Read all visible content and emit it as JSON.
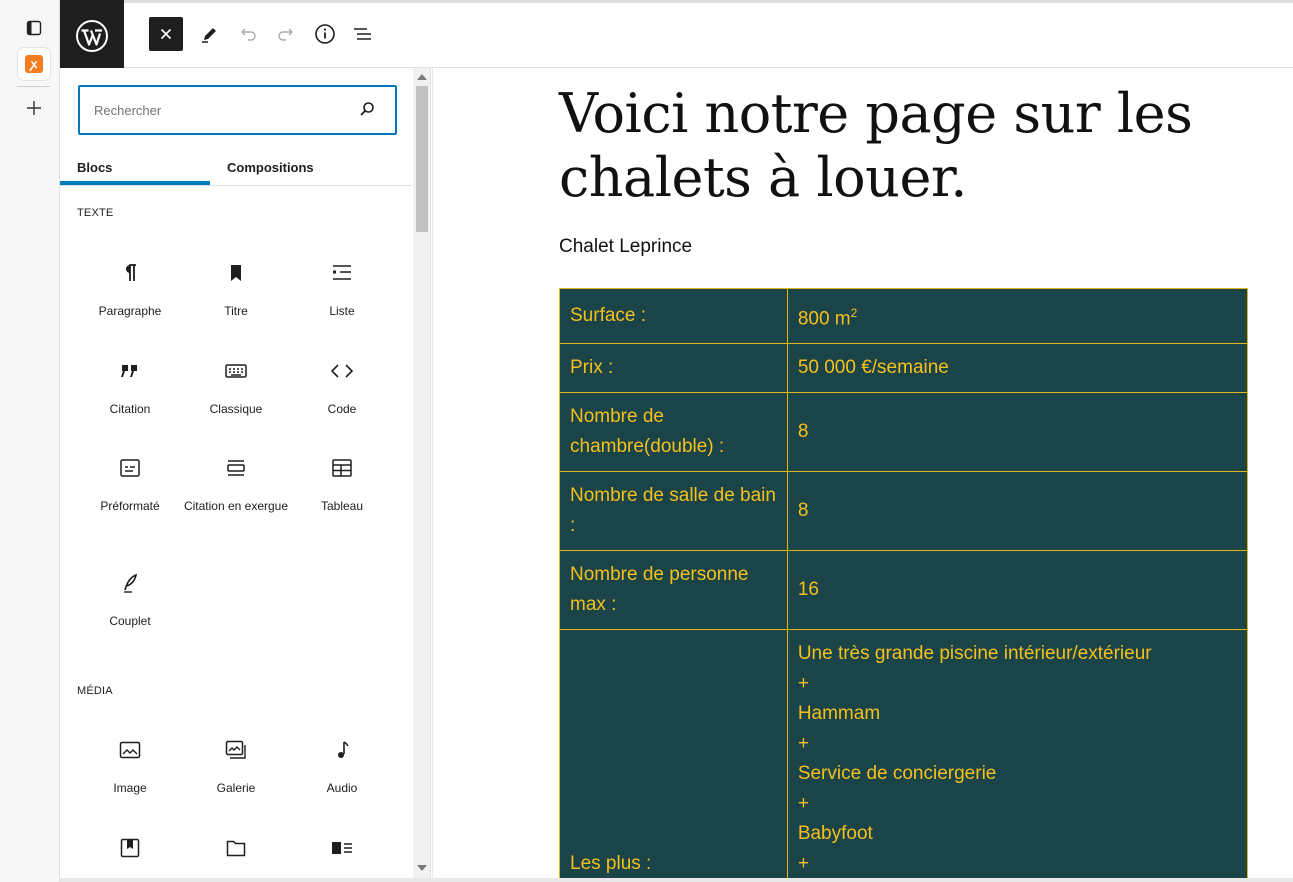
{
  "browser_rail": {
    "items": [
      {
        "icon": "sidebar-toggle-icon"
      },
      {
        "icon": "xampp-icon",
        "glyph": "ꭗ"
      },
      {
        "icon": "plus-icon"
      }
    ]
  },
  "toolbar": {
    "logo_icon": "wordpress-logo-icon",
    "close_label": "Fermer",
    "buttons": [
      "close-icon",
      "pencil-icon",
      "undo-icon",
      "redo-icon",
      "info-icon",
      "list-view-icon"
    ]
  },
  "inserter": {
    "search_placeholder": "Rechercher",
    "tabs": [
      {
        "label": "Blocs",
        "active": true
      },
      {
        "label": "Compositions",
        "active": false
      }
    ],
    "categories": [
      {
        "label": "TEXTE",
        "blocks": [
          {
            "label": "Paragraphe",
            "icon": "paragraph-icon"
          },
          {
            "label": "Titre",
            "icon": "bookmark-icon"
          },
          {
            "label": "Liste",
            "icon": "list-icon"
          },
          {
            "label": "Citation",
            "icon": "quote-icon"
          },
          {
            "label": "Classique",
            "icon": "keyboard-icon"
          },
          {
            "label": "Code",
            "icon": "code-icon"
          },
          {
            "label": "Préformaté",
            "icon": "preformatted-icon"
          },
          {
            "label": "Citation en exergue",
            "icon": "pullquote-icon"
          },
          {
            "label": "Tableau",
            "icon": "table-icon"
          },
          {
            "label": "Couplet",
            "icon": "feather-icon"
          }
        ]
      },
      {
        "label": "MÉDIA",
        "blocks": [
          {
            "label": "Image",
            "icon": "image-icon"
          },
          {
            "label": "Galerie",
            "icon": "gallery-icon"
          },
          {
            "label": "Audio",
            "icon": "audio-icon"
          },
          {
            "label": "",
            "icon": "cover-icon"
          },
          {
            "label": "",
            "icon": "file-icon"
          },
          {
            "label": "",
            "icon": "media-text-icon"
          }
        ]
      }
    ]
  },
  "content": {
    "title": "Voici notre page sur les chalets à louer.",
    "subtitle": "Chalet Leprince",
    "table": {
      "rows": [
        {
          "key": "Surface :",
          "value": "800 m",
          "sup": "2"
        },
        {
          "key": "Prix :",
          "value": "50 000 €/semaine"
        },
        {
          "key": "Nombre de chambre(double) :",
          "value": "8"
        },
        {
          "key": "Nombre de salle de bain :",
          "value": "8"
        },
        {
          "key": "Nombre de personne max :",
          "value": "16"
        }
      ],
      "plus_key": "Les plus :",
      "plus_items": [
        "Une très grande piscine intérieur/extérieur",
        "+",
        "Hammam",
        "+",
        "Service de conciergerie",
        "+",
        "Babyfoot",
        "+"
      ]
    }
  },
  "colors": {
    "table_bg": "#1b4448",
    "table_text": "#f5c01b",
    "accent": "#007cba"
  }
}
